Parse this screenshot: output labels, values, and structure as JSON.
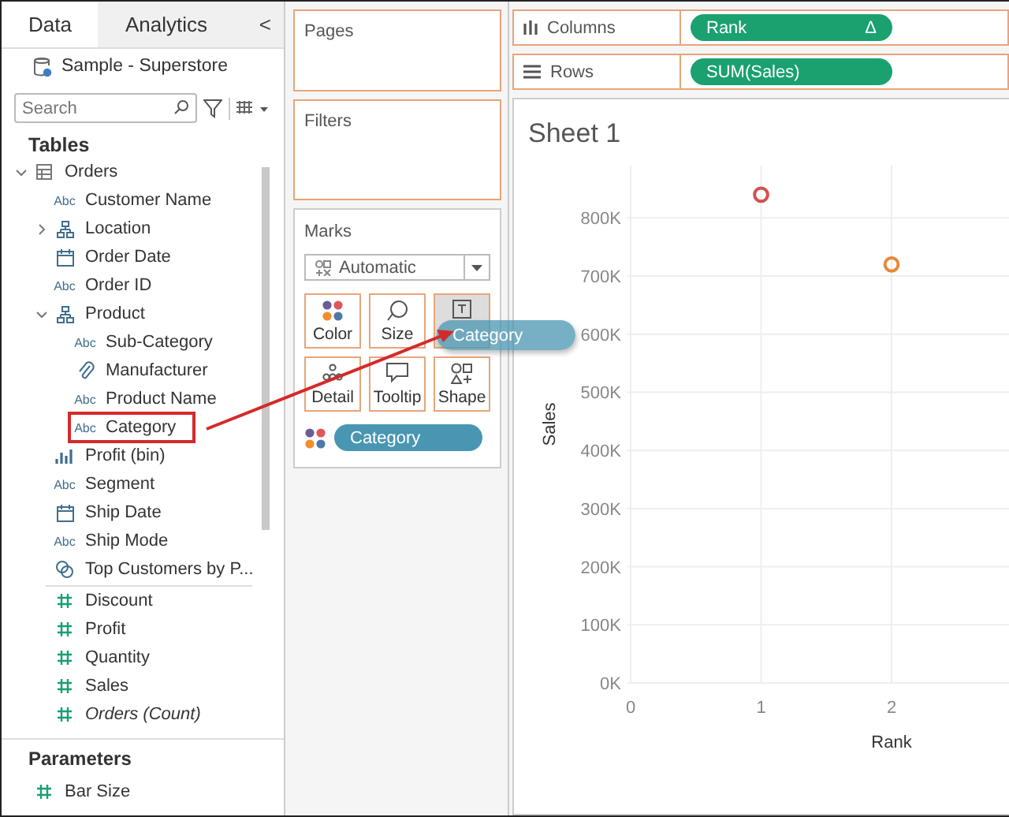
{
  "data_pane": {
    "tabs": [
      {
        "label": "Data",
        "selected": true
      },
      {
        "label": "Analytics",
        "selected": false
      }
    ],
    "collapse": "<",
    "datasource": "Sample - Superstore",
    "search": {
      "placeholder": "Search"
    },
    "tables_heading": "Tables",
    "tree": [
      {
        "label": "Orders",
        "kind": "table",
        "expanded": true,
        "children": [
          {
            "label": "Customer Name",
            "kind": "string",
            "glyph": "Abc"
          },
          {
            "label": "Location",
            "kind": "hierarchy",
            "expanded": false
          },
          {
            "label": "Order Date",
            "kind": "date"
          },
          {
            "label": "Order ID",
            "kind": "string",
            "glyph": "Abc"
          },
          {
            "label": "Product",
            "kind": "hierarchy",
            "expanded": true,
            "children": [
              {
                "label": "Sub-Category",
                "kind": "string",
                "glyph": "Abc"
              },
              {
                "label": "Manufacturer",
                "kind": "group"
              },
              {
                "label": "Product Name",
                "kind": "string",
                "glyph": "Abc"
              },
              {
                "label": "Category",
                "kind": "string",
                "glyph": "Abc",
                "highlighted": true
              }
            ]
          },
          {
            "label": "Profit (bin)",
            "kind": "bin"
          },
          {
            "label": "Segment",
            "kind": "string",
            "glyph": "Abc"
          },
          {
            "label": "Ship Date",
            "kind": "date"
          },
          {
            "label": "Ship Mode",
            "kind": "string",
            "glyph": "Abc"
          },
          {
            "label": "Top Customers by P...",
            "kind": "set"
          },
          {
            "label": "Discount",
            "kind": "measure",
            "divider_before": true
          },
          {
            "label": "Profit",
            "kind": "measure"
          },
          {
            "label": "Quantity",
            "kind": "measure"
          },
          {
            "label": "Sales",
            "kind": "measure"
          },
          {
            "label": "Orders (Count)",
            "kind": "measure",
            "italic": true
          }
        ]
      }
    ],
    "parameters_heading": "Parameters",
    "parameters": [
      {
        "label": "Bar Size",
        "kind": "measure"
      }
    ]
  },
  "shelves": {
    "pages": "Pages",
    "filters": "Filters",
    "marks": {
      "title": "Marks",
      "mark_type": "Automatic",
      "cards": [
        {
          "kind": "color",
          "label": "Color"
        },
        {
          "kind": "size",
          "label": "Size"
        },
        {
          "kind": "label",
          "hovered": true
        },
        {
          "kind": "detail",
          "label": "Detail"
        },
        {
          "kind": "tooltip",
          "label": "Tooltip"
        },
        {
          "kind": "shape",
          "label": "Shape"
        }
      ],
      "pills": [
        {
          "kind": "color",
          "label": "Category"
        }
      ]
    },
    "columns": {
      "label": "Columns",
      "pill": {
        "label": "Rank",
        "glyph": "Δ"
      }
    },
    "rows": {
      "label": "Rows",
      "pill": {
        "label": "SUM(Sales)"
      }
    }
  },
  "drag_pill": {
    "label": "Category"
  },
  "sheet": {
    "title": "Sheet 1",
    "chart_data": {
      "type": "scatter",
      "grid": true,
      "xlabel": "Rank",
      "ylabel": "Sales",
      "x": [
        1,
        2
      ],
      "series": [
        {
          "color": "#d1514f",
          "values": [
            840000,
            null
          ]
        },
        {
          "color": "#e8883a",
          "values": [
            null,
            720000
          ]
        }
      ],
      "xlim": [
        0,
        2.9
      ],
      "ylim": [
        0,
        890000
      ],
      "xticks": [
        0,
        1,
        2
      ],
      "yticks": [
        {
          "value": 0,
          "label": "0K"
        },
        {
          "value": 100000,
          "label": "100K"
        },
        {
          "value": 200000,
          "label": "200K"
        },
        {
          "value": 300000,
          "label": "300K"
        },
        {
          "value": 400000,
          "label": "400K"
        },
        {
          "value": 500000,
          "label": "500K"
        },
        {
          "value": 600000,
          "label": "600K"
        },
        {
          "value": 700000,
          "label": "700K"
        },
        {
          "value": 800000,
          "label": "800K"
        }
      ]
    }
  }
}
